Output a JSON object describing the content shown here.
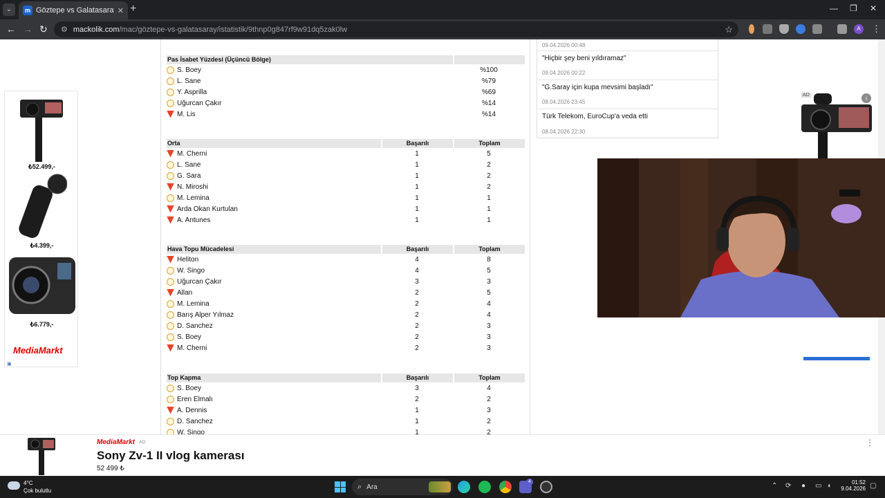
{
  "browser": {
    "tab_title": "Göztepe vs Galatasaray, Takım İ",
    "favicon_letter": "m",
    "url_host": "mackolik.com",
    "url_path": "/mac/göztepe-vs-galatasaray/istatistik/9thnp0g847rf9w91dq5zak0lw",
    "profile_letter": "A"
  },
  "stats": {
    "pass_accuracy": {
      "header": "Pas İsabet Yüzdesi (Üçüncü Bölge)",
      "rows": [
        {
          "team": "gs",
          "name": "S. Boey",
          "value": "%100"
        },
        {
          "team": "gs",
          "name": "L. Sane",
          "value": "%79"
        },
        {
          "team": "gs",
          "name": "Y. Asprilla",
          "value": "%69"
        },
        {
          "team": "gs",
          "name": "Uğurcan Çakır",
          "value": "%14"
        },
        {
          "team": "goz",
          "name": "M. Lis",
          "value": "%14"
        }
      ]
    },
    "orta": {
      "header": "Orta",
      "col1": "Başarılı",
      "col2": "Toplam",
      "rows": [
        {
          "team": "goz",
          "name": "M. Cherni",
          "a": "1",
          "b": "5"
        },
        {
          "team": "gs",
          "name": "L. Sane",
          "a": "1",
          "b": "2"
        },
        {
          "team": "gs",
          "name": "G. Sara",
          "a": "1",
          "b": "2"
        },
        {
          "team": "goz",
          "name": "N. Miroshi",
          "a": "1",
          "b": "2"
        },
        {
          "team": "gs",
          "name": "M. Lemina",
          "a": "1",
          "b": "1"
        },
        {
          "team": "goz",
          "name": "Arda Okan Kurtulan",
          "a": "1",
          "b": "1"
        },
        {
          "team": "goz",
          "name": "A. Antunes",
          "a": "1",
          "b": "1"
        }
      ]
    },
    "hava": {
      "header": "Hava Topu Mücadelesi",
      "col1": "Başarılı",
      "col2": "Toplam",
      "rows": [
        {
          "team": "goz",
          "name": "Heliton",
          "a": "4",
          "b": "8"
        },
        {
          "team": "gs",
          "name": "W. Singo",
          "a": "4",
          "b": "5"
        },
        {
          "team": "gs",
          "name": "Uğurcan Çakır",
          "a": "3",
          "b": "3"
        },
        {
          "team": "goz",
          "name": "Allan",
          "a": "2",
          "b": "5"
        },
        {
          "team": "gs",
          "name": "M. Lemina",
          "a": "2",
          "b": "4"
        },
        {
          "team": "gs",
          "name": "Barış Alper Yılmaz",
          "a": "2",
          "b": "4"
        },
        {
          "team": "gs",
          "name": "D. Sanchez",
          "a": "2",
          "b": "3"
        },
        {
          "team": "gs",
          "name": "S. Boey",
          "a": "2",
          "b": "3"
        },
        {
          "team": "goz",
          "name": "M. Cherni",
          "a": "2",
          "b": "3"
        }
      ]
    },
    "top_kapma": {
      "header": "Top Kapma",
      "col1": "Başarılı",
      "col2": "Toplam",
      "rows": [
        {
          "team": "gs",
          "name": "S. Boey",
          "a": "3",
          "b": "4"
        },
        {
          "team": "gs",
          "name": "Eren Elmalı",
          "a": "2",
          "b": "2"
        },
        {
          "team": "goz",
          "name": "A. Dennis",
          "a": "1",
          "b": "3"
        },
        {
          "team": "gs",
          "name": "D. Sanchez",
          "a": "1",
          "b": "2"
        },
        {
          "team": "gs",
          "name": "W. Singo",
          "a": "1",
          "b": "2"
        }
      ]
    }
  },
  "news": [
    {
      "title": "",
      "date": "09.04.2026 00:48"
    },
    {
      "title": "\"Hiçbir şey beni yıldıramaz\"",
      "date": "09.04.2026 00:22"
    },
    {
      "title": "\"G.Saray için kupa mevsimi başladı\"",
      "date": "08.04.2026 23:45"
    },
    {
      "title": "Türk Telekom, EuroCup'a veda etti",
      "date": "08.04.2026 22:30"
    }
  ],
  "left_ad": {
    "prices": [
      "₺52.499,-",
      "₺4.399,-",
      "₺6.779,-"
    ],
    "brand": "MediaMarkt"
  },
  "right_ad": {
    "badge": "AD",
    "info": "i"
  },
  "bottom_ad": {
    "brand": "MediaMarkt",
    "ad_tag": "AD",
    "title": "Sony Zv-1 II vlog kamerası",
    "price": "52 499 ₺"
  },
  "taskbar": {
    "temp": "4°C",
    "weather": "Çok bulutlu",
    "search": "Ara",
    "time": "01:52",
    "date": "9.04.2026",
    "badge": "4"
  }
}
